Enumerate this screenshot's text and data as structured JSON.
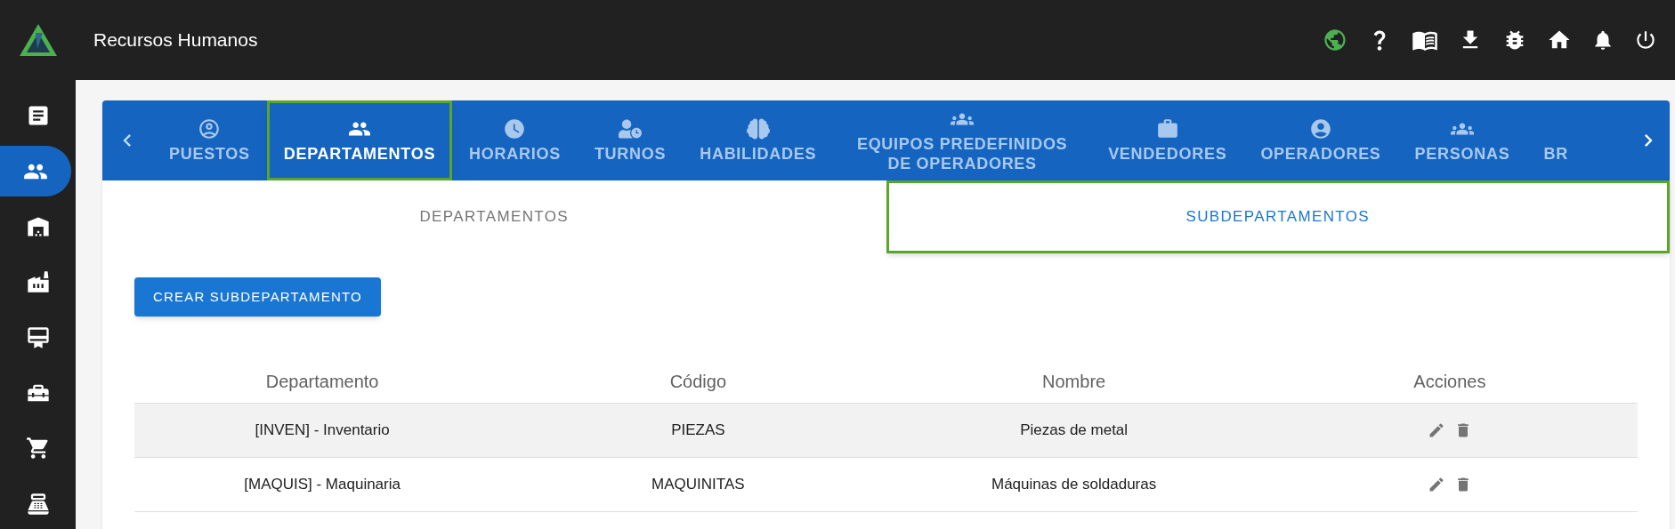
{
  "header": {
    "title": "Recursos Humanos"
  },
  "sidebar": {
    "items": [
      {
        "selected": false
      },
      {
        "selected": true
      },
      {
        "selected": false
      },
      {
        "selected": false
      },
      {
        "selected": false
      },
      {
        "selected": false
      },
      {
        "selected": false
      },
      {
        "selected": false
      }
    ]
  },
  "tabs": [
    {
      "label": "PUESTOS",
      "selected": false
    },
    {
      "label": "DEPARTAMENTOS",
      "selected": true
    },
    {
      "label": "HORARIOS",
      "selected": false
    },
    {
      "label": "TURNOS",
      "selected": false
    },
    {
      "label": "HABILIDADES",
      "selected": false
    },
    {
      "label": "EQUIPOS PREDEFINIDOS DE OPERADORES",
      "selected": false
    },
    {
      "label": "VENDEDORES",
      "selected": false
    },
    {
      "label": "OPERADORES",
      "selected": false
    },
    {
      "label": "PERSONAS",
      "selected": false
    },
    {
      "label": "BR",
      "selected": false
    }
  ],
  "subtabs": [
    {
      "label": "DEPARTAMENTOS",
      "selected": false
    },
    {
      "label": "SUBDEPARTAMENTOS",
      "selected": true
    }
  ],
  "create_button": "CREAR SUBDEPARTAMENTO",
  "table": {
    "columns": [
      "Departamento",
      "Código",
      "Nombre",
      "Acciones"
    ],
    "rows": [
      {
        "cells": [
          "[INVEN] - Inventario",
          "PIEZAS",
          "Piezas de metal"
        ],
        "selected": true
      },
      {
        "cells": [
          "[MAQUIS] - Maquinaria",
          "MAQUINITAS",
          "Máquinas de soldaduras"
        ],
        "selected": false
      }
    ]
  }
}
